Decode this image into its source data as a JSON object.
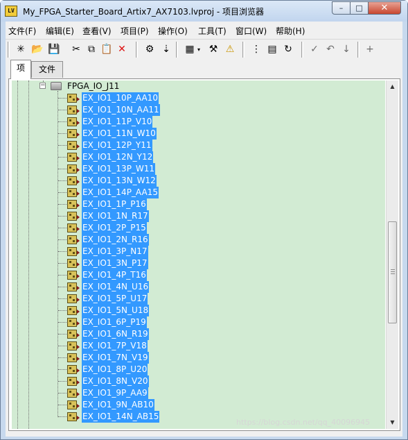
{
  "window": {
    "app_icon_label": "LV",
    "title": "My_FPGA_Starter_Board_Artix7_AX7103.lvproj - 项目浏览器",
    "controls": {
      "minimize": "–",
      "maximize": "□",
      "close": "✕"
    }
  },
  "menu": [
    "文件(F)",
    "编辑(E)",
    "查看(V)",
    "项目(P)",
    "操作(O)",
    "工具(T)",
    "窗口(W)",
    "帮助(H)"
  ],
  "toolbar": {
    "icons": [
      {
        "name": "new-icon",
        "glyph": "✳"
      },
      {
        "name": "open-icon",
        "glyph": "📂"
      },
      {
        "name": "save-all-icon",
        "glyph": "💾"
      },
      {
        "name": "cut-icon",
        "glyph": "✂"
      },
      {
        "name": "copy-icon",
        "glyph": "⧉"
      },
      {
        "name": "paste-icon",
        "glyph": "📋"
      },
      {
        "name": "delete-icon",
        "glyph": "✕"
      },
      {
        "name": "build-icon",
        "glyph": "⚙"
      },
      {
        "name": "deploy-icon",
        "glyph": "⇣"
      },
      {
        "name": "view-icon",
        "glyph": "▦"
      },
      {
        "name": "dropdown-arrow-icon",
        "glyph": "▾"
      },
      {
        "name": "settings-icon",
        "glyph": "⚒"
      },
      {
        "name": "warning-icon",
        "glyph": "⚠"
      },
      {
        "name": "arrange-icon",
        "glyph": "⋮"
      },
      {
        "name": "library-icon",
        "glyph": "▤"
      },
      {
        "name": "refresh-icon",
        "glyph": "↻"
      },
      {
        "name": "check-icon",
        "glyph": "✓"
      },
      {
        "name": "undo-icon",
        "glyph": "↶"
      },
      {
        "name": "move-down-icon",
        "glyph": "↓"
      },
      {
        "name": "add-icon",
        "glyph": "+"
      }
    ]
  },
  "tabs": {
    "items": "项",
    "files": "文件"
  },
  "tree": {
    "folder": {
      "expander": "−",
      "label": "FPGA_IO_J11"
    },
    "items": [
      "EX_IO1_10P_AA10",
      "EX_IO1_10N_AA11",
      "EX_IO1_11P_V10",
      "EX_IO1_11N_W10",
      "EX_IO1_12P_Y11",
      "EX_IO1_12N_Y12",
      "EX_IO1_13P_W11",
      "EX_IO1_13N_W12",
      "EX_IO1_14P_AA15",
      "EX_IO1_1P_P16",
      "EX_IO1_1N_R17",
      "EX_IO1_2P_P15",
      "EX_IO1_2N_R16",
      "EX_IO1_3P_N17",
      "EX_IO1_3N_P17",
      "EX_IO1_4P_T16",
      "EX_IO1_4N_U16",
      "EX_IO1_5P_U17",
      "EX_IO1_5N_U18",
      "EX_IO1_6P_P19",
      "EX_IO1_6N_R19",
      "EX_IO1_7P_V18",
      "EX_IO1_7N_V19",
      "EX_IO1_8P_U20",
      "EX_IO1_8N_V20",
      "EX_IO1_9P_AA9",
      "EX_IO1_9N_AB10",
      "EX_IO1_14N_AB15"
    ]
  },
  "scrollbar": {
    "up_arrow": "▲",
    "down_arrow": "▼"
  },
  "watermark": "https://blog.csdn.net/qq_40096945"
}
